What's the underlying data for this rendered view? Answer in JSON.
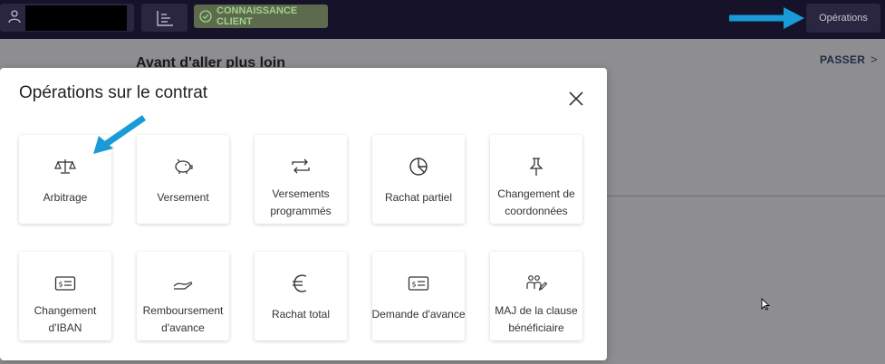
{
  "topbar": {
    "kyc_label": "CONNAISSANCE CLIENT",
    "operations_label": "Opérations"
  },
  "background": {
    "title": "Avant d'aller plus loin",
    "skip_label": "PASSER",
    "skip_chevron": ">"
  },
  "modal": {
    "title": "Opérations sur le contrat",
    "tiles": [
      {
        "icon": "scale-icon",
        "line1": "Arbitrage",
        "line2": ""
      },
      {
        "icon": "piggy-bank-icon",
        "line1": "Versement",
        "line2": ""
      },
      {
        "icon": "repeat-arrows-icon",
        "line1": "Versements",
        "line2": "programmés"
      },
      {
        "icon": "pie-chart-icon",
        "line1": "Rachat partiel",
        "line2": ""
      },
      {
        "icon": "pin-icon",
        "line1": "Changement de",
        "line2": "coordonnées"
      },
      {
        "icon": "bank-check-icon",
        "line1": "Changement",
        "line2": "d'IBAN"
      },
      {
        "icon": "hand-coin-icon",
        "line1": "Remboursement",
        "line2": "d'avance"
      },
      {
        "icon": "euro-icon",
        "line1": "Rachat total",
        "line2": ""
      },
      {
        "icon": "bank-check-icon",
        "line1": "Demande d'avance",
        "line2": ""
      },
      {
        "icon": "beneficiaries-icon",
        "line1": "MAJ de la clause",
        "line2": "bénéficiaire"
      }
    ]
  },
  "colors": {
    "topbar_bg": "#16122a",
    "kyc_text": "#9fd28a",
    "annotation_arrow": "#1a9ad6"
  }
}
